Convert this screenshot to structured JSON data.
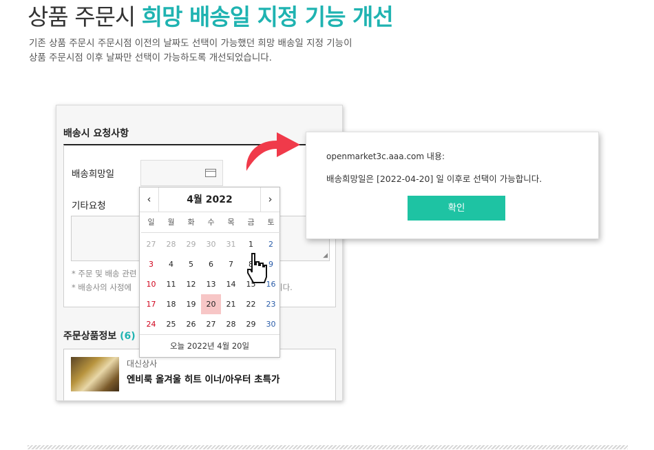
{
  "header": {
    "title_plain": "상품 주문시",
    "title_accent": "희망 배송일 지정 기능 개선",
    "description_line1": "기존 상품 주문시 주문시점 이전의 날짜도 선택이 가능했던 희망 배송일 지정 기능이",
    "description_line2": "상품 주문시점 이후 날짜만 선택이 가능하도록 개선되었습니다."
  },
  "form": {
    "section_title": "배송시 요청사항",
    "delivery_date_label": "배송희망일",
    "delivery_date_value": "",
    "other_request_label": "기타요청",
    "note1": "* 주문 및 배송 관련",
    "note2": "* 배송사의 사정에",
    "note2_tail": "니다."
  },
  "products": {
    "title": "주문상품정보",
    "count": "(6)",
    "item": {
      "seller": "대신상사",
      "name": "엔비룩 올겨울 히트 이너/아우터 초특가"
    }
  },
  "calendar": {
    "prev_icon": "‹",
    "next_icon": "›",
    "month_label": "4월 2022",
    "weekdays": [
      "일",
      "월",
      "화",
      "수",
      "목",
      "금",
      "토"
    ],
    "days": [
      {
        "d": "27",
        "k": "other"
      },
      {
        "d": "28",
        "k": "other"
      },
      {
        "d": "29",
        "k": "other"
      },
      {
        "d": "30",
        "k": "other"
      },
      {
        "d": "31",
        "k": "other"
      },
      {
        "d": "1",
        "k": ""
      },
      {
        "d": "2",
        "k": "sat"
      },
      {
        "d": "3",
        "k": "sun"
      },
      {
        "d": "4",
        "k": ""
      },
      {
        "d": "5",
        "k": ""
      },
      {
        "d": "6",
        "k": ""
      },
      {
        "d": "7",
        "k": ""
      },
      {
        "d": "8",
        "k": ""
      },
      {
        "d": "9",
        "k": "sat"
      },
      {
        "d": "10",
        "k": "sun"
      },
      {
        "d": "11",
        "k": ""
      },
      {
        "d": "12",
        "k": ""
      },
      {
        "d": "13",
        "k": ""
      },
      {
        "d": "14",
        "k": ""
      },
      {
        "d": "15",
        "k": ""
      },
      {
        "d": "16",
        "k": "sat"
      },
      {
        "d": "17",
        "k": "sun"
      },
      {
        "d": "18",
        "k": ""
      },
      {
        "d": "19",
        "k": ""
      },
      {
        "d": "20",
        "k": "selected"
      },
      {
        "d": "21",
        "k": ""
      },
      {
        "d": "22",
        "k": ""
      },
      {
        "d": "23",
        "k": "sat"
      },
      {
        "d": "24",
        "k": "sun"
      },
      {
        "d": "25",
        "k": ""
      },
      {
        "d": "26",
        "k": ""
      },
      {
        "d": "27",
        "k": ""
      },
      {
        "d": "28",
        "k": ""
      },
      {
        "d": "29",
        "k": ""
      },
      {
        "d": "30",
        "k": "sat"
      }
    ],
    "today_label": "오늘 2022년 4월 20일"
  },
  "dialog": {
    "origin": "openmarket3c.aaa.com 내용:",
    "message": "배송희망일은 [2022-04-20] 일 이후로 선택이 가능합니다.",
    "confirm_label": "확인"
  },
  "colors": {
    "accent": "#1fb3b1",
    "confirm_button": "#1ec3a3",
    "selected_day": "#f7c6c6",
    "arrow": "#f03a4a",
    "sunday": "#d0021b",
    "saturday": "#2a5ca8"
  },
  "icons": {
    "date_picker": "calendar-icon",
    "pointer": "hand-pointer-icon",
    "callout": "curved-arrow-icon"
  }
}
